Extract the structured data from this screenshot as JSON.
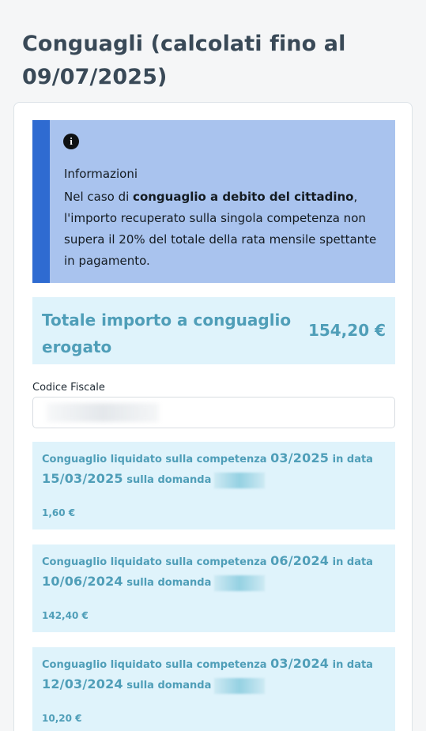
{
  "page": {
    "title": "Conguagli (calcolati fino al 09/07/2025)"
  },
  "info": {
    "icon": "info-circle-icon",
    "heading": "Informazioni",
    "text_before": "Nel caso di ",
    "text_bold": "conguaglio a debito del cittadino",
    "text_after": ", l'importo recuperato sulla singola competenza non supera il 20% del totale della rata mensile spettante in pagamento."
  },
  "total": {
    "label": "Totale importo a conguaglio erogato",
    "value": "154,20 €"
  },
  "codice_fiscale": {
    "label": "Codice Fiscale"
  },
  "entries": [
    {
      "prefix": "Conguaglio liquidato sulla competenza ",
      "competenza": "03/2025",
      "middle": " in data",
      "date": "15/03/2025",
      "suffix": " sulla domanda",
      "amount": "1,60 €"
    },
    {
      "prefix": "Conguaglio liquidato sulla competenza ",
      "competenza": "06/2024",
      "middle": " in data",
      "date": "10/06/2024",
      "suffix": " sulla domanda",
      "amount": "142,40 €"
    },
    {
      "prefix": "Conguaglio liquidato sulla competenza ",
      "competenza": "03/2024",
      "middle": " in data",
      "date": "12/03/2024",
      "suffix": " sulla domanda",
      "amount": "10,20 €"
    }
  ],
  "colors": {
    "title": "#394957",
    "info_bg": "#a9c3ee",
    "info_border": "#2f6bd1",
    "entry_bg": "#dff3fb",
    "accent_text": "#4f9eb8"
  }
}
